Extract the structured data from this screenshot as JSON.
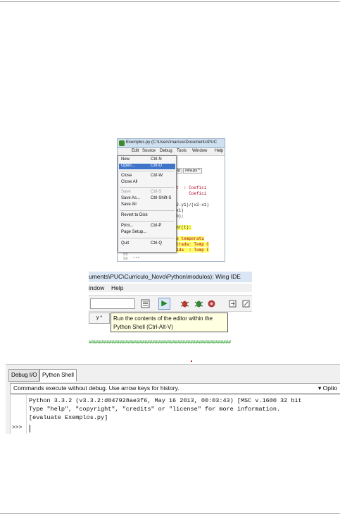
{
  "menu_window": {
    "title": "Exemplos.py (C:\\Users\\marcus\\Documents\\PUC",
    "menubar": [
      "Edit",
      "Source",
      "Debug",
      "Tools",
      "Window",
      "Help"
    ],
    "tabs": [
      "ip",
      "reta.py *"
    ],
    "file_menu": {
      "items": [
        {
          "label": "New",
          "accel": "Ctrl-N"
        },
        {
          "label": "Open...",
          "accel": "Ctrl-O",
          "selected": true
        },
        {
          "label": "Close",
          "accel": "Ctrl-W"
        },
        {
          "label": "Close All",
          "accel": ""
        },
        {
          "label": "Save",
          "accel": "Ctrl-S",
          "disabled": true
        },
        {
          "label": "Save As...",
          "accel": "Ctrl-Shift-S"
        },
        {
          "label": "Save All",
          "accel": ""
        },
        {
          "label": "Revert to Disk",
          "accel": ""
        },
        {
          "label": "Print...",
          "accel": "Ctrl-P"
        },
        {
          "label": "Page Setup...",
          "accel": ""
        },
        {
          "label": "Quit",
          "accel": "Ctrl-Q"
        }
      ]
    },
    "code_lines": [
      "put  : Coefici",
      "       Coefici",
      "(y2-y1)/(x2-x1)",
      "x*x1)",
      "t,b);",
      "fahr(t):",
      "rte temperatu",
      "Entrada: Temp C",
      "Saida  : Temp F"
    ],
    "line_numbers": [
      "55",
      "56"
    ],
    "docstring": "\"\"\""
  },
  "toolbar_window": {
    "title": "uments\\PUC\\Curriculo_Novo\\Python\\modulos): Wing IDE",
    "menubar": [
      "indow",
      "Help"
    ],
    "tab_label": "y *",
    "tooltip": "Run the contents of the editor within the Python Shell (Ctrl-Alt-V)",
    "hash_line": "########################################################"
  },
  "shell_panel": {
    "tabs": [
      "Debug I/O",
      "Python Shell"
    ],
    "status": "Commands execute without debug.  Use arrow keys for history.",
    "options_label": "▾ Optio",
    "output_lines": [
      "Python 3.3.2 (v3.3.2:d047928ae3f6, May 16 2013, 00:03:43) [MSC v.1600 32 bit",
      "Type \"help\", \"copyright\", \"credits\" or \"license\" for more information.",
      "[evaluate Exemplos.py]"
    ],
    "prompt": ">>>"
  },
  "colors": {
    "menu_highlight": "#3f74c9",
    "tooltip_bg": "#ffffe1",
    "code_highlight": "#ffff66",
    "run_icon": "#1e8a2a"
  }
}
